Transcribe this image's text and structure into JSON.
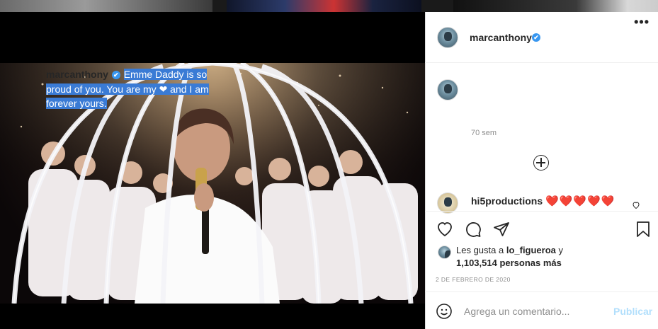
{
  "post": {
    "username": "marcanthony",
    "verified_badge": "✔",
    "more_label": "•••",
    "caption_segments": [
      "Emme Daddy is so",
      "proud of you. You are my ",
      "❤",
      " and I am",
      "forever yours."
    ],
    "caption_age": "70 sem",
    "load_more_icon": "plus-circle-icon"
  },
  "comments": [
    {
      "username": "hi5productions",
      "text": "❤️❤️❤️❤️❤️"
    }
  ],
  "actions": {
    "like_icon": "heart-icon",
    "comment_icon": "comment-icon",
    "share_icon": "paper-plane-icon",
    "save_icon": "bookmark-icon"
  },
  "likes": {
    "prefix": "Les gusta a ",
    "user": "lo_figueroa",
    "conj": " y",
    "count": "1,103,514",
    "suffix": " personas más"
  },
  "date": "2 DE FEBRERO DE 2020",
  "comment_box": {
    "emoji_icon": "smiley-icon",
    "placeholder": "Agrega un comentario...",
    "publish_label": "Publicar"
  },
  "colors": {
    "accent": "#3897f0",
    "highlight": "#3a7bd5",
    "publish_disabled": "#b2dffc",
    "heart_red": "#e0142c"
  }
}
